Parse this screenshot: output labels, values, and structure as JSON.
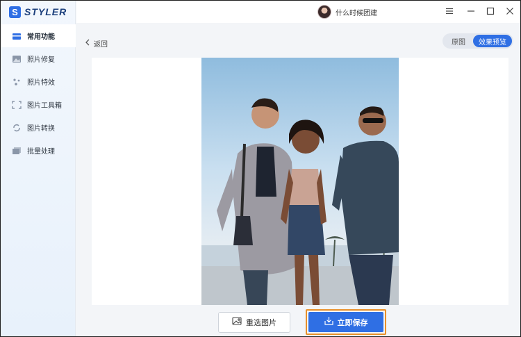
{
  "app": {
    "logo_letter": "S",
    "name": "STYLER"
  },
  "sidebar": {
    "items": [
      {
        "label": "常用功能",
        "icon": "toolbox-icon",
        "active": true
      },
      {
        "label": "照片修复",
        "icon": "image-restore-icon",
        "active": false
      },
      {
        "label": "照片特效",
        "icon": "sparkle-icon",
        "active": false
      },
      {
        "label": "图片工具箱",
        "icon": "crop-frame-icon",
        "active": false
      },
      {
        "label": "图片转换",
        "icon": "convert-cycle-icon",
        "active": false
      },
      {
        "label": "批量处理",
        "icon": "batch-stack-icon",
        "active": false
      }
    ]
  },
  "titlebar": {
    "username": "什么时候团建",
    "controls": [
      "menu-icon",
      "minimize-icon",
      "maximize-icon",
      "close-icon"
    ]
  },
  "main": {
    "back_label": "返回",
    "view_toggle": {
      "original": "原图",
      "preview": "效果预览",
      "selected": "效果预览"
    }
  },
  "actions": {
    "reselect_label": "重选图片",
    "save_label": "立即保存"
  },
  "colors": {
    "accent": "#2f6fe4",
    "highlight_border": "#e8902a"
  }
}
